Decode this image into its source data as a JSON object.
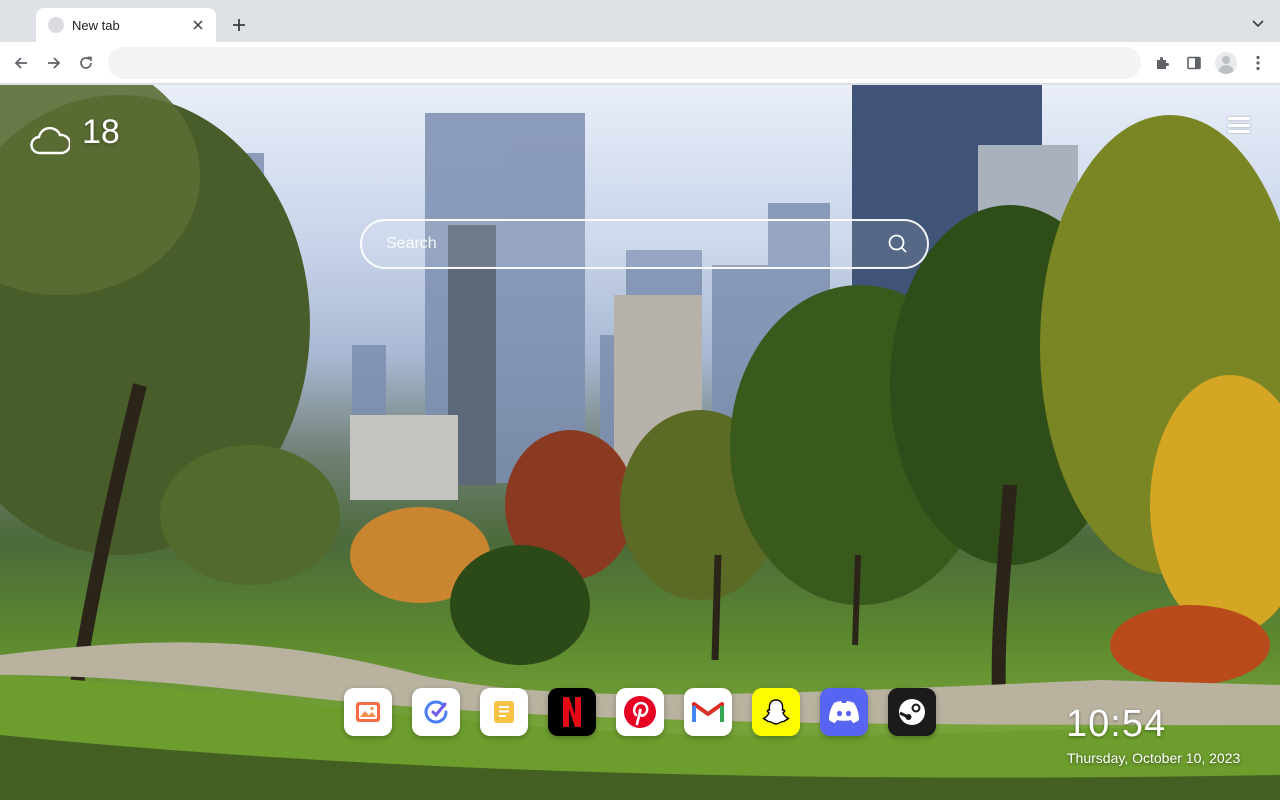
{
  "browser": {
    "tab": {
      "title": "New tab"
    },
    "omnibox": {
      "value": "",
      "placeholder": ""
    }
  },
  "newtab": {
    "weather": {
      "temperature": "18",
      "condition_icon": "cloud-icon"
    },
    "search": {
      "placeholder": "Search"
    },
    "apps": [
      {
        "name": "Photos",
        "icon": "photo-icon",
        "color": "#ffffff"
      },
      {
        "name": "Tasks",
        "icon": "check-circle-icon",
        "color": "#ffffff"
      },
      {
        "name": "Notes",
        "icon": "notes-icon",
        "color": "#ffffff"
      },
      {
        "name": "Netflix",
        "icon": "netflix-icon",
        "color": "#000000"
      },
      {
        "name": "Pinterest",
        "icon": "pinterest-icon",
        "color": "#ffffff"
      },
      {
        "name": "Gmail",
        "icon": "gmail-icon",
        "color": "#ffffff"
      },
      {
        "name": "Snapchat",
        "icon": "snapchat-icon",
        "color": "#fffc00"
      },
      {
        "name": "Discord",
        "icon": "discord-icon",
        "color": "#5865f2"
      },
      {
        "name": "Steam",
        "icon": "steam-icon",
        "color": "#1b1b1b"
      }
    ],
    "clock": {
      "time": "10:54",
      "date": "Thursday, October 10, 2023"
    }
  },
  "colors": {
    "chrome_bg": "#dee1e6",
    "omnibox_bg": "#f1f3f4",
    "text": "#202124"
  }
}
